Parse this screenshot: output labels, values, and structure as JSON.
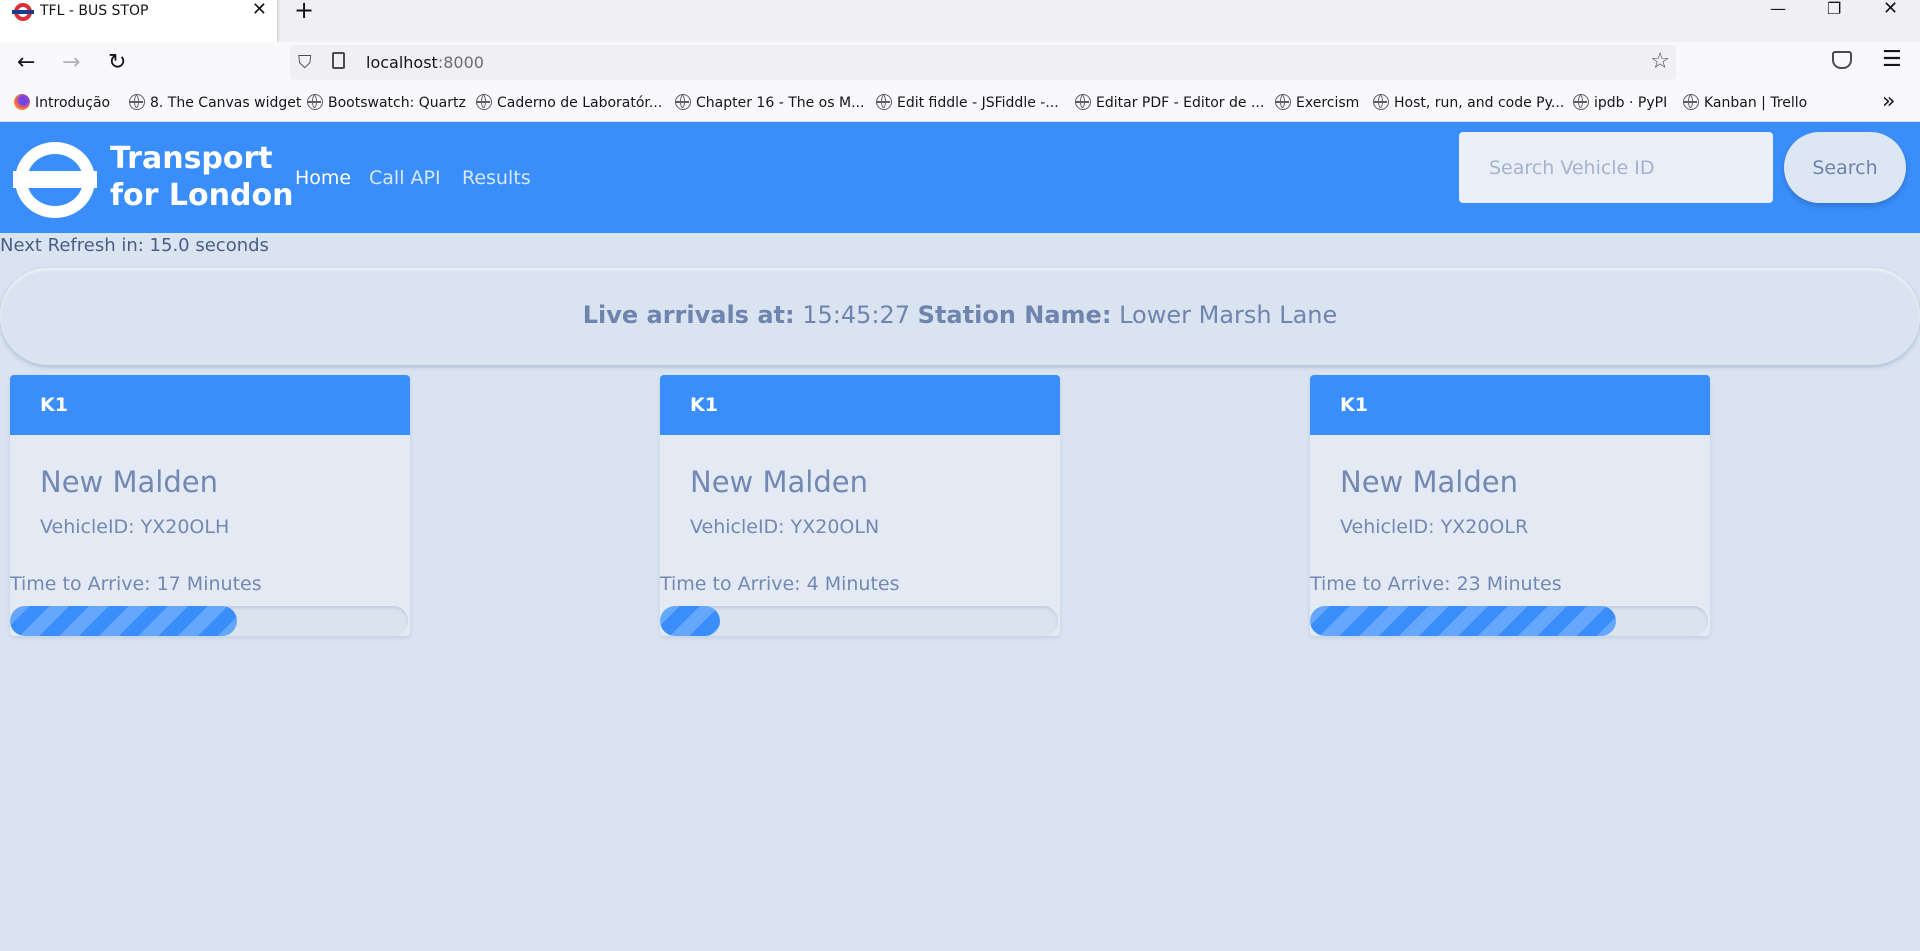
{
  "browser": {
    "tab_title": "TFL - BUS STOP",
    "url_host": "localhost",
    "url_port": ":8000",
    "bookmarks": [
      "Introdução",
      "8. The Canvas widget",
      "Bootswatch: Quartz",
      "Caderno de Laboratór...",
      "Chapter 16 - The os M...",
      "Edit fiddle - JSFiddle -...",
      "Editar PDF - Editor de ...",
      "Exercism",
      "Host, run, and code Py...",
      "ipdb · PyPI",
      "Kanban | Trello"
    ]
  },
  "header": {
    "brand_line1": "Transport",
    "brand_line2": "for London",
    "nav": [
      "Home",
      "Call API",
      "Results"
    ],
    "active_nav": "Home",
    "search_placeholder": "Search Vehicle ID",
    "search_button": "Search",
    "accent_color": "#3a8efb"
  },
  "status": {
    "refresh_text": "Next Refresh in: 15.0 seconds"
  },
  "banner": {
    "arrivals_label": "Live arrivals at:",
    "time": "15:45:27",
    "station_label": "Station Name:",
    "station": "Lower Marsh Lane"
  },
  "arrivals": [
    {
      "route": "K1",
      "destination": "New Malden",
      "vehicle": "VehicleID: YX20OLH",
      "time_to_arrive": "Time to Arrive: 17 Minutes",
      "progress": 0.57
    },
    {
      "route": "K1",
      "destination": "New Malden",
      "vehicle": "VehicleID: YX20OLN",
      "time_to_arrive": "Time to Arrive: 4 Minutes",
      "progress": 0.15
    },
    {
      "route": "K1",
      "destination": "New Malden",
      "vehicle": "VehicleID: YX20OLR",
      "time_to_arrive": "Time to Arrive: 23 Minutes",
      "progress": 0.77
    }
  ]
}
